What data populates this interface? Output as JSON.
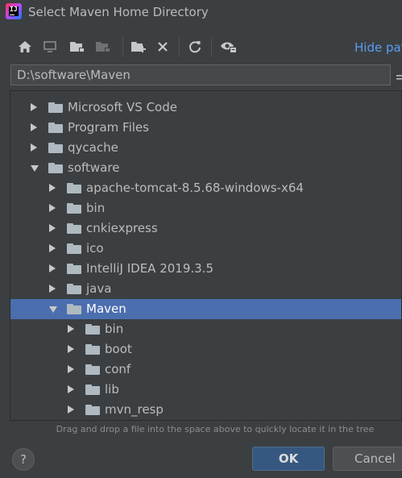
{
  "window": {
    "title": "Select Maven Home Directory"
  },
  "toolbar": {
    "buttons": [
      "home-icon",
      "desktop-icon",
      "project-folder-icon",
      "module-folder-icon",
      "new-folder-icon",
      "delete-icon",
      "refresh-icon",
      "show-hidden-icon"
    ],
    "hide_path_label": "Hide path"
  },
  "path_field": {
    "value": "D:\\software\\Maven"
  },
  "tree": {
    "items": [
      {
        "label": "Microsoft VS Code",
        "level": 1,
        "expanded": false,
        "selected": false
      },
      {
        "label": "Program Files",
        "level": 1,
        "expanded": false,
        "selected": false
      },
      {
        "label": "qycache",
        "level": 1,
        "expanded": false,
        "selected": false
      },
      {
        "label": "software",
        "level": 1,
        "expanded": true,
        "selected": false
      },
      {
        "label": "apache-tomcat-8.5.68-windows-x64",
        "level": 2,
        "expanded": false,
        "selected": false
      },
      {
        "label": "bin",
        "level": 2,
        "expanded": false,
        "selected": false
      },
      {
        "label": "cnkiexpress",
        "level": 2,
        "expanded": false,
        "selected": false
      },
      {
        "label": "ico",
        "level": 2,
        "expanded": false,
        "selected": false
      },
      {
        "label": "IntelliJ IDEA 2019.3.5",
        "level": 2,
        "expanded": false,
        "selected": false
      },
      {
        "label": "java",
        "level": 2,
        "expanded": false,
        "selected": false
      },
      {
        "label": "Maven",
        "level": 2,
        "expanded": true,
        "selected": true
      },
      {
        "label": "bin",
        "level": 3,
        "expanded": false,
        "selected": false
      },
      {
        "label": "boot",
        "level": 3,
        "expanded": false,
        "selected": false
      },
      {
        "label": "conf",
        "level": 3,
        "expanded": false,
        "selected": false
      },
      {
        "label": "lib",
        "level": 3,
        "expanded": false,
        "selected": false
      },
      {
        "label": "mvn_resp",
        "level": 3,
        "expanded": false,
        "selected": false
      }
    ]
  },
  "hint": "Drag and drop a file into the space above to quickly locate it in the tree",
  "footer": {
    "help_label": "?",
    "ok_label": "OK",
    "cancel_label": "Cancel"
  },
  "colors": {
    "background": "#3c3f41",
    "selection": "#4b6eaf",
    "link": "#589df6",
    "ok_button": "#365880",
    "folder": "#aeb9c0"
  }
}
